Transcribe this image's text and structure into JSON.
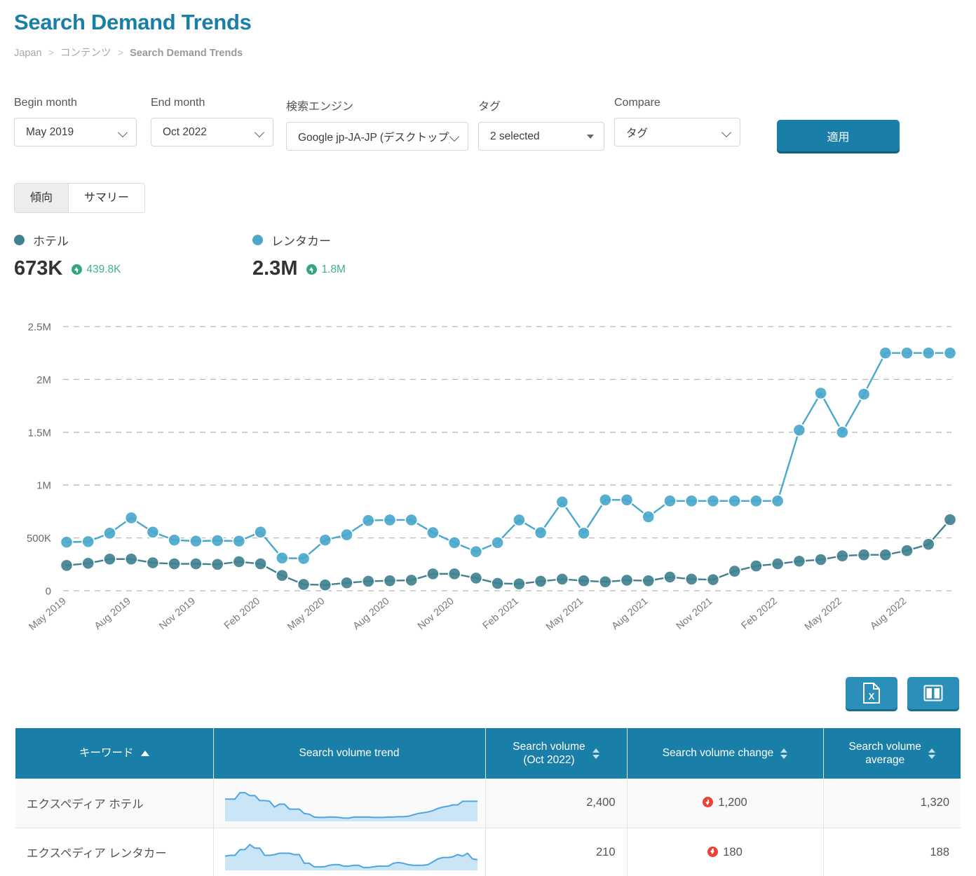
{
  "header": {
    "title": "Search Demand Trends",
    "breadcrumb": [
      "Japan",
      "コンテンツ",
      "Search Demand Trends"
    ],
    "sep": ">"
  },
  "filters": {
    "begin_month": {
      "label": "Begin month",
      "value": "May 2019"
    },
    "end_month": {
      "label": "End month",
      "value": "Oct 2022"
    },
    "search_engine": {
      "label": "検索エンジン",
      "value": "Google jp-JA-JP (デスクトップ)"
    },
    "tag": {
      "label": "タグ",
      "value": "2 selected"
    },
    "compare": {
      "label": "Compare",
      "value": "タグ"
    },
    "apply_label": "適用"
  },
  "tabs": [
    {
      "label": "傾向",
      "active": true
    },
    {
      "label": "サマリー",
      "active": false
    }
  ],
  "kpis": [
    {
      "name": "ホテル",
      "value": "673K",
      "delta": "439.8K",
      "direction": "up",
      "color": "#40818f"
    },
    {
      "name": "レンタカー",
      "value": "2.3M",
      "delta": "1.8M",
      "direction": "up",
      "color": "#4aa8cc"
    }
  ],
  "chart_data": {
    "type": "line",
    "title": "",
    "xlabel": "",
    "ylabel": "",
    "ylim": [
      0,
      2500000
    ],
    "grid": true,
    "legend_position": "top-left",
    "ytick_labels": [
      "2.5M",
      "2M",
      "1.5M",
      "1M",
      "500K",
      "0"
    ],
    "ytick_values": [
      2500000,
      2000000,
      1500000,
      1000000,
      500000,
      0
    ],
    "x": [
      "May 2019",
      "Jun 2019",
      "Jul 2019",
      "Aug 2019",
      "Sep 2019",
      "Oct 2019",
      "Nov 2019",
      "Dec 2019",
      "Jan 2020",
      "Feb 2020",
      "Mar 2020",
      "Apr 2020",
      "May 2020",
      "Jun 2020",
      "Jul 2020",
      "Aug 2020",
      "Sep 2020",
      "Oct 2020",
      "Nov 2020",
      "Dec 2020",
      "Jan 2021",
      "Feb 2021",
      "Mar 2021",
      "Apr 2021",
      "May 2021",
      "Jun 2021",
      "Jul 2021",
      "Aug 2021",
      "Sep 2021",
      "Oct 2021",
      "Nov 2021",
      "Dec 2021",
      "Jan 2022",
      "Feb 2022",
      "Mar 2022",
      "Apr 2022",
      "May 2022",
      "Jun 2022",
      "Jul 2022",
      "Aug 2022",
      "Sep 2022",
      "Oct 2022"
    ],
    "xtick_labels": [
      "May 2019",
      "Aug 2019",
      "Nov 2019",
      "Feb 2020",
      "May 2020",
      "Aug 2020",
      "Nov 2020",
      "Feb 2021",
      "May 2021",
      "Aug 2021",
      "Nov 2021",
      "Feb 2022",
      "May 2022",
      "Aug 2022"
    ],
    "xtick_indices": [
      0,
      3,
      6,
      9,
      12,
      15,
      18,
      21,
      24,
      27,
      30,
      33,
      36,
      39
    ],
    "series": [
      {
        "name": "レンタカー",
        "color": "#4aa8cc",
        "values": [
          460000,
          465000,
          545000,
          690000,
          555000,
          480000,
          470000,
          475000,
          470000,
          555000,
          310000,
          305000,
          480000,
          530000,
          665000,
          670000,
          670000,
          550000,
          455000,
          370000,
          455000,
          670000,
          550000,
          840000,
          545000,
          860000,
          860000,
          700000,
          850000,
          850000,
          850000,
          850000,
          850000,
          850000,
          1520000,
          1870000,
          1500000,
          1860000,
          2250000,
          2250000,
          2250000,
          2250000
        ]
      },
      {
        "name": "ホテル",
        "color": "#40818f",
        "values": [
          240000,
          260000,
          300000,
          300000,
          265000,
          255000,
          255000,
          250000,
          275000,
          255000,
          145000,
          60000,
          55000,
          75000,
          90000,
          95000,
          100000,
          160000,
          160000,
          120000,
          70000,
          65000,
          90000,
          110000,
          95000,
          85000,
          100000,
          95000,
          130000,
          110000,
          105000,
          185000,
          235000,
          255000,
          280000,
          295000,
          330000,
          340000,
          340000,
          380000,
          440000,
          673000
        ]
      }
    ]
  },
  "exports": [
    {
      "name": "excel-export-button",
      "icon": "excel-icon"
    },
    {
      "name": "columns-toggle-button",
      "icon": "columns-icon"
    }
  ],
  "table": {
    "columns": [
      {
        "label": "キーワード",
        "sort": "asc",
        "align": "left"
      },
      {
        "label": "Search volume trend",
        "sort": "none",
        "align": "center"
      },
      {
        "label": "Search volume\n(Oct 2022)",
        "sort": "both",
        "align": "right"
      },
      {
        "label": "Search volume change",
        "sort": "both",
        "align": "center"
      },
      {
        "label": "Search volume\naverage",
        "sort": "both",
        "align": "right"
      }
    ],
    "rows": [
      {
        "keyword": "エクスペディア ホテル",
        "volume": "2,400",
        "change": "1,200",
        "change_direction": "down",
        "average": "1,320",
        "sparkline": [
          62,
          62,
          62,
          80,
          80,
          72,
          72,
          58,
          58,
          56,
          40,
          48,
          48,
          34,
          34,
          34,
          22,
          20,
          12,
          11,
          11,
          12,
          12,
          11,
          9,
          9,
          12,
          12,
          12,
          12,
          11,
          11,
          11,
          12,
          12,
          13,
          13,
          14,
          18,
          22,
          24,
          26,
          30,
          36,
          40,
          42,
          46,
          46,
          56,
          56,
          56,
          56
        ]
      },
      {
        "keyword": "エクスペディア レンタカー",
        "volume": "210",
        "change": "180",
        "change_direction": "down",
        "average": "188",
        "sparkline": [
          40,
          42,
          42,
          58,
          58,
          72,
          62,
          62,
          42,
          42,
          44,
          48,
          48,
          48,
          44,
          44,
          20,
          20,
          10,
          10,
          10,
          14,
          16,
          16,
          12,
          12,
          14,
          14,
          8,
          8,
          10,
          12,
          12,
          12,
          20,
          22,
          20,
          16,
          14,
          14,
          14,
          16,
          24,
          32,
          36,
          36,
          38,
          44,
          40,
          48,
          32,
          30
        ]
      }
    ]
  }
}
